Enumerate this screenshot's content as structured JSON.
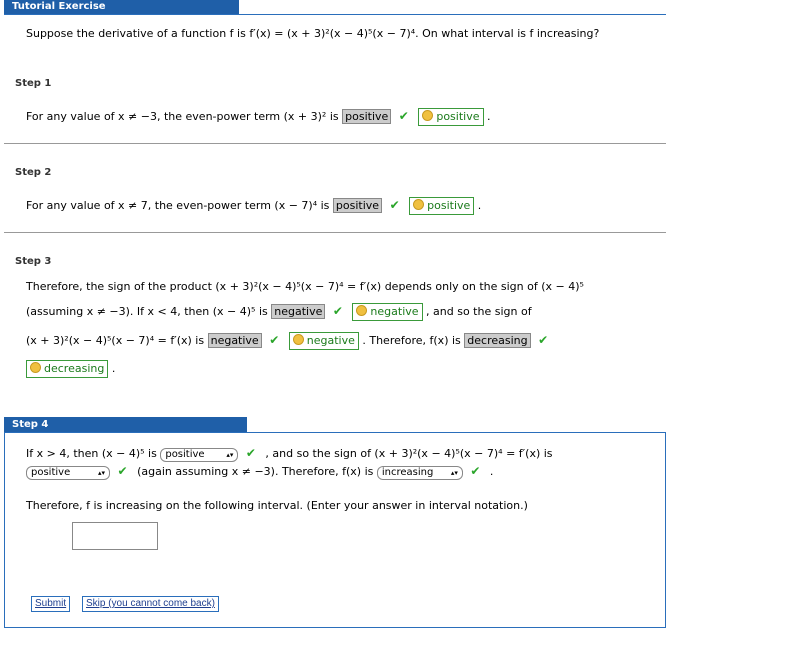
{
  "header": {
    "title": "Tutorial Exercise"
  },
  "question": {
    "text": "Suppose the derivative of a function f is f′(x) = (x + 3)²(x − 4)⁵(x − 7)⁴. On what interval is f increasing?"
  },
  "step1": {
    "label": "Step 1",
    "text_before": "For any value of x ≠ −3, the even-power term  (x + 3)² is",
    "answer": "positive",
    "key_answer": "positive"
  },
  "step2": {
    "label": "Step 2",
    "text_before": "For any value of x ≠ 7, the even-power term  (x − 7)⁴ is",
    "answer": "positive",
    "key_answer": "positive"
  },
  "step3": {
    "label": "Step 3",
    "line1": "Therefore, the sign of the product  (x + 3)²(x − 4)⁵(x − 7)⁴ = f′(x)  depends only on the sign of  (x − 4)⁵",
    "line2_before": "(assuming x ≠ −3).  If x < 4, then  (x − 4)⁵  is",
    "answer1": "negative",
    "key_answer1": "negative",
    "line2_after": ", and so the sign of",
    "line3_before": "(x + 3)²(x − 4)⁵(x − 7)⁴ = f′(x)  is",
    "answer2": "negative",
    "key_answer2": "negative",
    "line3_after": ". Therefore,  f(x)  is",
    "answer3": "decreasing",
    "key_answer3": "decreasing"
  },
  "step4": {
    "label": "Step 4",
    "line1_a": "If x > 4, then  (x − 4)⁵  is",
    "select1": "positive",
    "line1_b": ", and so the sign of  (x + 3)²(x − 4)⁵(x − 7)⁴ = f′(x)  is",
    "select2": "positive",
    "line2_b": "(again assuming x ≠ −3). Therefore,  f(x)  is",
    "select3": "increasing",
    "instruction": "Therefore, f is increasing on the following interval. (Enter your answer in interval notation.)",
    "input_value": "",
    "submit_label": "Submit",
    "skip_label": "Skip (you cannot come back)"
  },
  "colors": {
    "accent": "#1f5fa8",
    "check": "#2aa52a",
    "key_border": "#3a9a3a"
  },
  "icons": {
    "check": "check-icon",
    "key": "key-icon",
    "dropdown": "chevron-down-icon"
  }
}
